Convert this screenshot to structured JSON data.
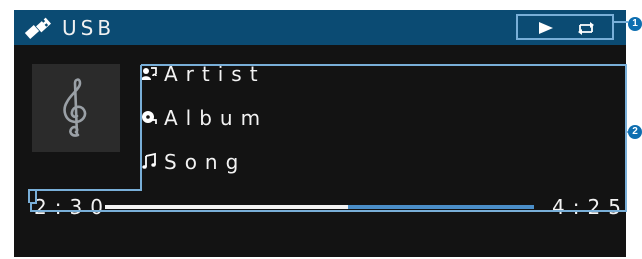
{
  "header": {
    "source_label": "USB",
    "icons": {
      "source": "usb-stick-icon",
      "play": "play-icon",
      "repeat": "repeat-icon"
    }
  },
  "now_playing": {
    "album_art_icon": "treble-clef-icon",
    "artist": "Artist",
    "album": "Album",
    "song": "Song",
    "icons": {
      "artist": "artist-icon",
      "album": "album-icon",
      "song": "music-note-icon"
    }
  },
  "playback": {
    "elapsed": "2:30",
    "total": "4:25",
    "progress_fraction": 0.566
  },
  "callouts": {
    "status": "1",
    "playback_info": "2"
  },
  "colors": {
    "header_bg": "#0b4b73",
    "screen_bg": "#131313",
    "accent": "#4b8ec8",
    "callout": "#0d6eb0",
    "outline": "#79afd8"
  }
}
